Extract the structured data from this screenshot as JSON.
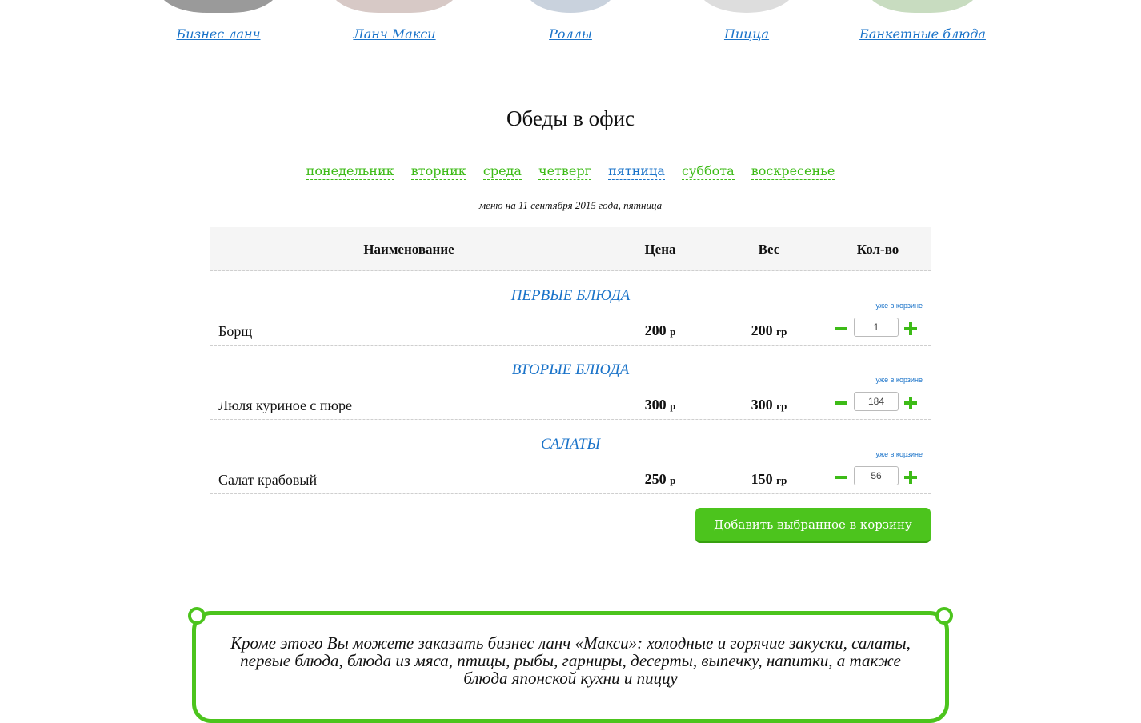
{
  "categories": [
    {
      "label": "Бизнес ланч",
      "plate_color": "#9a9a9a"
    },
    {
      "label": "Ланч Макси",
      "plate_color": "#d7c9c6"
    },
    {
      "label": "Роллы",
      "plate_color": "#c9d2dd"
    },
    {
      "label": "Пицца",
      "plate_color": "#dddddd"
    },
    {
      "label": "Банкетные блюда",
      "plate_color": "#c8dcc0"
    }
  ],
  "page_title": "Обеды в офис",
  "days": [
    {
      "label": "понедельник",
      "active": false
    },
    {
      "label": "вторник",
      "active": false
    },
    {
      "label": "среда",
      "active": false
    },
    {
      "label": "четверг",
      "active": false
    },
    {
      "label": "пятница",
      "active": true
    },
    {
      "label": "суббота",
      "active": false
    },
    {
      "label": "воскресенье",
      "active": false
    }
  ],
  "menu_date": "меню на 11 сентября 2015 года, пятница",
  "table": {
    "headers": {
      "name": "Наименование",
      "price": "Цена",
      "weight": "Вес",
      "qty": "Кол-во"
    },
    "groups": [
      {
        "title": "ПЕРВЫЕ БЛЮДА",
        "in_cart": "уже в корзине",
        "item": {
          "name": "Борщ",
          "price": "200",
          "price_unit": "р",
          "weight": "200",
          "weight_unit": "гр",
          "qty": "1"
        }
      },
      {
        "title": "ВТОРЫЕ БЛЮДА",
        "in_cart": "уже в корзине",
        "item": {
          "name": "Люля куриное с пюре",
          "price": "300",
          "price_unit": "р",
          "weight": "300",
          "weight_unit": "гр",
          "qty": "184"
        }
      },
      {
        "title": "САЛАТЫ",
        "in_cart": "уже в корзине",
        "item": {
          "name": "Салат крабовый",
          "price": "250",
          "price_unit": "р",
          "weight": "150",
          "weight_unit": "гр",
          "qty": "56"
        }
      }
    ]
  },
  "add_button": "Добавить выбранное в корзину",
  "promo_text": "Кроме этого Вы можете заказать бизнес ланч «Макси»: холодные и горячие закуски, салаты, первые блюда, блюда из мяса, птицы, рыбы, гарниры, десерты, выпечку, напитки, а также блюда японской кухни и пиццу",
  "colors": {
    "accent_green": "#4cc41d",
    "link_blue": "#1a73c9",
    "day_green": "#3dbb17"
  }
}
